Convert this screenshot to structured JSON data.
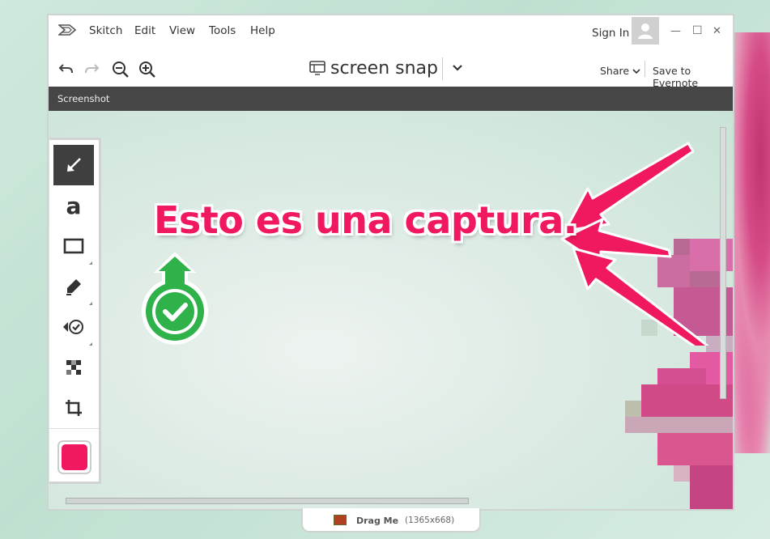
{
  "app": {
    "name": "Skitch"
  },
  "menu": {
    "items": [
      "Skitch",
      "Edit",
      "View",
      "Tools",
      "Help"
    ],
    "sign_in": "Sign In"
  },
  "toolbar": {
    "document_title": "screen snap",
    "share_label": "Share",
    "save_label": "Save to Evernote"
  },
  "label_bar": {
    "text": "Screenshot"
  },
  "canvas": {
    "annotation_text": "Esto es una captura.",
    "annotation_color": "#f0185f",
    "stamp_color": "#2fb24a"
  },
  "tools": [
    {
      "name": "arrow-tool",
      "icon": "arrow-icon",
      "active": true
    },
    {
      "name": "text-tool",
      "icon": "text-a-icon",
      "active": false
    },
    {
      "name": "rectangle-tool",
      "icon": "rectangle-icon",
      "active": false
    },
    {
      "name": "marker-tool",
      "icon": "marker-icon",
      "active": false
    },
    {
      "name": "stamp-tool",
      "icon": "stamp-check-icon",
      "active": false
    },
    {
      "name": "pixelate-tool",
      "icon": "pixelate-icon",
      "active": false
    },
    {
      "name": "crop-tool",
      "icon": "crop-icon",
      "active": false
    }
  ],
  "color_swatch": "#f0185f",
  "drag_me": {
    "label": "Drag Me",
    "dimensions": "(1365x668)"
  }
}
